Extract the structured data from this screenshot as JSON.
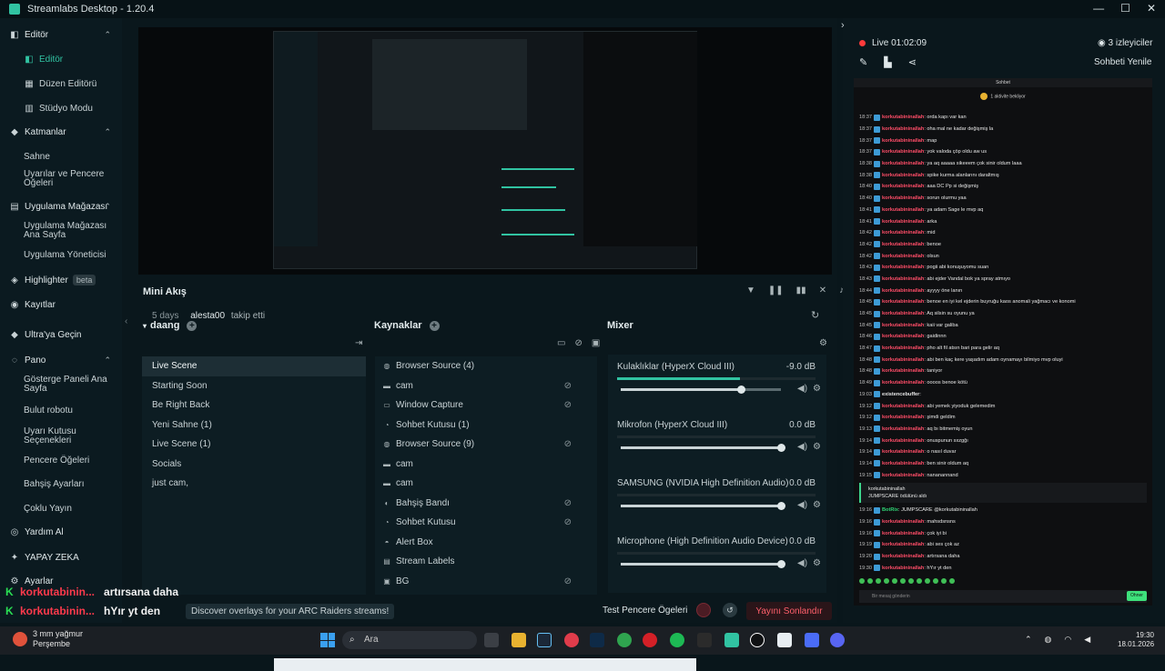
{
  "window": {
    "title": "Streamlabs Desktop - 1.20.4"
  },
  "sidebar": {
    "items": [
      {
        "label": "Editör",
        "kind": "sec",
        "icon": "editor-icon"
      },
      {
        "label": "Editör",
        "kind": "sub-active",
        "icon": "editor-icon"
      },
      {
        "label": "Düzen Editörü",
        "kind": "sub",
        "icon": "layout-icon"
      },
      {
        "label": "Stüdyo Modu",
        "kind": "sub",
        "icon": "studio-icon"
      },
      {
        "label": "Katmanlar",
        "kind": "sec",
        "icon": "layers-icon"
      },
      {
        "label": "Sahne",
        "kind": "plain"
      },
      {
        "label": "Uyarılar ve Pencere Öğeleri",
        "kind": "plain"
      },
      {
        "label": "Uygulama Mağazası",
        "kind": "sec",
        "icon": "store-icon"
      },
      {
        "label": "Uygulama Mağazası Ana Sayfa",
        "kind": "plain"
      },
      {
        "label": "Uygulama Yöneticisi",
        "kind": "plain"
      },
      {
        "label": "Highlighter",
        "kind": "sec",
        "icon": "highlighter-icon",
        "badge": "beta"
      },
      {
        "label": "Kayıtlar",
        "kind": "sec",
        "icon": "recordings-icon"
      },
      {
        "label": "Ultra'ya Geçin",
        "kind": "sec",
        "icon": "ultra-icon"
      },
      {
        "label": "Pano",
        "kind": "sec",
        "icon": "dashboard-icon"
      },
      {
        "label": "Gösterge Paneli Ana Sayfa",
        "kind": "plain"
      },
      {
        "label": "Bulut robotu",
        "kind": "plain"
      },
      {
        "label": "Uyarı Kutusu Seçenekleri",
        "kind": "plain"
      },
      {
        "label": "Pencere Öğeleri",
        "kind": "plain"
      },
      {
        "label": "Bahşiş Ayarları",
        "kind": "plain"
      },
      {
        "label": "Çoklu Yayın",
        "kind": "plain"
      },
      {
        "label": "Yardım Al",
        "kind": "sec",
        "icon": "help-icon"
      },
      {
        "label": "YAPAY ZEKA",
        "kind": "sec",
        "icon": "ai-icon"
      },
      {
        "label": "Ayarlar",
        "kind": "sec",
        "icon": "settings-icon"
      }
    ]
  },
  "miniFeed": {
    "title": "Mini Akış",
    "event": {
      "ago": "5 days",
      "user": "alesta00",
      "action": "takip etti"
    }
  },
  "scenes": {
    "collection": "daang",
    "items": [
      "Live Scene",
      "Starting Soon",
      "Be Right Back",
      "Yeni Sahne (1)",
      "Live Scene (1)",
      "Socials",
      "just cam,"
    ],
    "selected": 0
  },
  "sources": {
    "title": "Kaynaklar",
    "items": [
      {
        "label": "Browser Source (4)",
        "icon": "globe-icon",
        "hidden": false
      },
      {
        "label": "cam",
        "icon": "folder-icon",
        "hidden": true
      },
      {
        "label": "Window Capture",
        "icon": "window-icon",
        "hidden": true
      },
      {
        "label": "Sohbet Kutusu (1)",
        "icon": "chat-icon",
        "hidden": false
      },
      {
        "label": "Browser Source (9)",
        "icon": "globe-icon",
        "hidden": true
      },
      {
        "label": "cam",
        "icon": "folder-icon",
        "hidden": false
      },
      {
        "label": "cam",
        "icon": "folder-icon",
        "hidden": false
      },
      {
        "label": "Bahşiş Bandı",
        "icon": "donation-icon",
        "hidden": true
      },
      {
        "label": "Sohbet Kutusu",
        "icon": "chat-icon",
        "hidden": true
      },
      {
        "label": "Alert Box",
        "icon": "bell-icon",
        "hidden": false
      },
      {
        "label": "Stream Labels",
        "icon": "label-icon",
        "hidden": false
      },
      {
        "label": "BG",
        "icon": "image-icon",
        "hidden": true
      }
    ]
  },
  "mixer": {
    "title": "Mixer",
    "channels": [
      {
        "name": "Kulaklıklar (HyperX Cloud III)",
        "db": "-9.0 dB",
        "level": 0.62,
        "volume": 0.75
      },
      {
        "name": "Mikrofon (HyperX Cloud III)",
        "db": "0.0 dB",
        "level": 0.0,
        "volume": 1.0
      },
      {
        "name": "SAMSUNG (NVIDIA High Definition Audio)",
        "db": "0.0 dB",
        "level": 0.0,
        "volume": 1.0
      },
      {
        "name": "Microphone (High Definition Audio Device)",
        "db": "0.0 dB",
        "level": 0.0,
        "volume": 1.0
      }
    ]
  },
  "bottom": {
    "discover": "Discover overlays for your ARC Raiders streams!",
    "test": "Test Pencere Ögeleri",
    "end": "Yayını Sonlandır"
  },
  "overlayChat": [
    {
      "user": "korkutabinin...",
      "text": "artırsana daha"
    },
    {
      "user": "korkutabinin...",
      "text": "hYır yt den"
    }
  ],
  "chatPanel": {
    "live": "Live 01:02:09",
    "viewers": "3 izleyiciler",
    "refresh": "Sohbeti Yenile",
    "header": "Sohbet",
    "pinned": "1 aktivite bekliyor",
    "messages": [
      {
        "t": "18:37",
        "u": "korkutabininallah",
        "m": ": orda kapı var kan"
      },
      {
        "t": "18:37",
        "u": "korkutabininallah",
        "m": ": oha mal ne kadar değişmiş la"
      },
      {
        "t": "18:37",
        "u": "korkutabininallah",
        "m": ": map"
      },
      {
        "t": "18:37",
        "u": "korkutabininallah",
        "m": ": yok valoda çöp oldu aw us"
      },
      {
        "t": "18:38",
        "u": "korkutabininallah",
        "m": ": ya aq aaaaa sikeeem çok sinir oldum laaa"
      },
      {
        "t": "18:38",
        "u": "korkutabininallah",
        "m": ": spike kurma alanlarını daraltmış"
      },
      {
        "t": "18:40",
        "u": "korkutabininallah",
        "m": ": aaa DC Pp si değişmiş"
      },
      {
        "t": "18:40",
        "u": "korkutabininallah",
        "m": ": sorun olurmu yaa"
      },
      {
        "t": "18:41",
        "u": "korkutabininallah",
        "m": ": ya adam Sage le mvp aq"
      },
      {
        "t": "18:41",
        "u": "korkutabininallah",
        "m": ": arka"
      },
      {
        "t": "18:42",
        "u": "korkutabininallah",
        "m": ": mid"
      },
      {
        "t": "18:42",
        "u": "korkutabininallah",
        "m": ": benoe"
      },
      {
        "t": "18:42",
        "u": "korkutabininallah",
        "m": ": olsun"
      },
      {
        "t": "18:43",
        "u": "korkutabininallah",
        "m": ": pogii abi konuşuyomu suan"
      },
      {
        "t": "18:43",
        "u": "korkutabininallah",
        "m": ": abi ejder Vandal bok ya spray atmıyo"
      },
      {
        "t": "18:44",
        "u": "korkutabininallah",
        "m": ": ayyyy öne lanın"
      },
      {
        "t": "18:45",
        "u": "korkutabininallah",
        "m": ": benoe en iyi kel ejderin buyruğu kaos anomali yağmacı ve konomi"
      },
      {
        "t": "18:45",
        "u": "korkutabininallah",
        "m": ": Aq silsin su oyunu ya"
      },
      {
        "t": "18:45",
        "u": "korkutabininallah",
        "m": ": kaii var galiba"
      },
      {
        "t": "18:46",
        "u": "korkutabininallah",
        "m": ": gaidinnn"
      },
      {
        "t": "18:47",
        "u": "korkutabininallah",
        "m": ": pho alt fil atsın bari para gelir aq"
      },
      {
        "t": "18:48",
        "u": "korkutabininallah",
        "m": ": abi ben kaç kere yaşadım adam oynamayı bilmiyo mvp oluyi"
      },
      {
        "t": "18:48",
        "u": "korkutabininallah",
        "m": ": taniyor"
      },
      {
        "t": "18:49",
        "u": "korkutabininallah",
        "m": ": oooos benoe kötü"
      },
      {
        "t": "19:03",
        "u": "existencebuffer",
        "m": ": ",
        "style": "gr"
      },
      {
        "t": "19:12",
        "u": "korkutabininallah",
        "m": ": abi yemek yiyoduk gelemedim"
      },
      {
        "t": "19:12",
        "u": "korkutabininallah",
        "m": ": şimdi geldim"
      },
      {
        "t": "19:13",
        "u": "korkutabininallah",
        "m": ": aq bı bitmemiş oyun"
      },
      {
        "t": "19:14",
        "u": "korkutabininallah",
        "m": ": onuspunun sxzgğı"
      },
      {
        "t": "19:14",
        "u": "korkutabininallah",
        "m": ": o nasıl duvar"
      },
      {
        "t": "19:14",
        "u": "korkutabininallah",
        "m": ": ben sinir oldum aq"
      },
      {
        "t": "19:15",
        "u": "korkutabininallah",
        "m": ": nananannand"
      }
    ],
    "redeem": {
      "user": "korkutabininallah",
      "text": "JUMPSCARE ödülünü aldı"
    },
    "messages2": [
      {
        "t": "19:16",
        "u": "BotRix",
        "m": ": JUMPSCARE @korkutabininallah",
        "style": "bot"
      },
      {
        "t": "19:16",
        "u": "korkutabininallah",
        "m": ": mahsdsnsns"
      },
      {
        "t": "19:16",
        "u": "korkutabininallah",
        "m": ": çok iyi bi"
      },
      {
        "t": "19:19",
        "u": "korkutabininallah",
        "m": ": abi ses çok az"
      },
      {
        "t": "19:20",
        "u": "korkutabininallah",
        "m": ": artırsana daha"
      },
      {
        "t": "19:30",
        "u": "korkutabininallah",
        "m": ": hYır yt den"
      }
    ],
    "input_placeholder": "Bir mesaj gönderin",
    "send": "Ohner"
  },
  "taskbar": {
    "weather_temp": "3 mm yağmur",
    "weather_day": "Perşembe",
    "search": "Ara",
    "time": "19:30",
    "date": "18.01.2026"
  },
  "colors": {
    "accent": "#31c3a2",
    "live": "#ff3b3b",
    "chatName": "#ff4d68"
  }
}
